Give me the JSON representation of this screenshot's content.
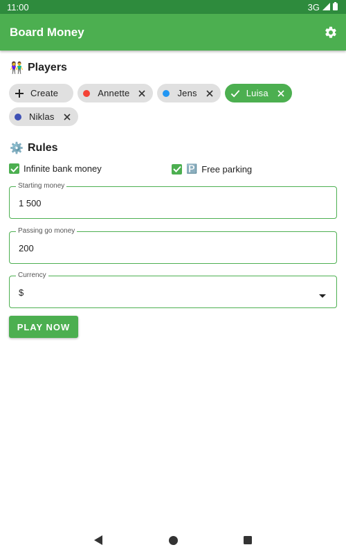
{
  "status_bar": {
    "time": "11:00",
    "network": "3G"
  },
  "app_bar": {
    "title": "Board Money",
    "settings_icon": "gear-icon"
  },
  "players": {
    "title": "Players",
    "icon_emoji": "👫",
    "create_label": "Create",
    "items": [
      {
        "name": "Annette",
        "color": "#f44336",
        "selected": false
      },
      {
        "name": "Jens",
        "color": "#2196f3",
        "selected": false
      },
      {
        "name": "Luisa",
        "color": "#4caf50",
        "selected": true
      },
      {
        "name": "Niklas",
        "color": "#3f51b5",
        "selected": false
      }
    ]
  },
  "rules": {
    "title": "Rules",
    "icon_emoji": "⚙️",
    "infinite_bank_label": "Infinite bank money",
    "infinite_bank_checked": true,
    "free_parking_emoji": "🅿️",
    "free_parking_label": "Free parking",
    "free_parking_checked": true,
    "starting_money": {
      "label": "Starting money",
      "value": "1 500"
    },
    "passing_go_money": {
      "label": "Passing go money",
      "value": "200"
    },
    "currency": {
      "label": "Currency",
      "value": "$"
    }
  },
  "play_button": {
    "label": "PLAY NOW"
  },
  "colors": {
    "primary": "#4caf50",
    "status_bar": "#2e8b3d"
  }
}
